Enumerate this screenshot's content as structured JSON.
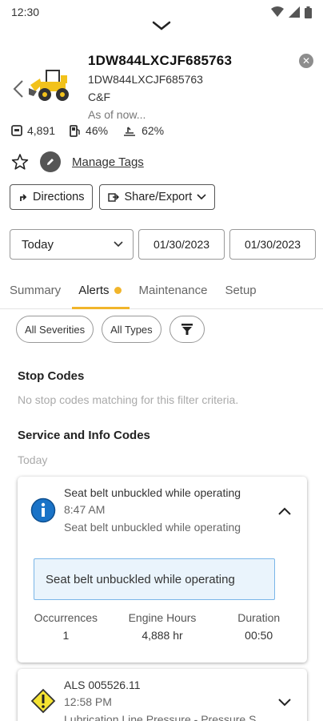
{
  "status_bar": {
    "time": "12:30"
  },
  "asset": {
    "id": "1DW844LXCJF685763",
    "serial": "1DW844LXCJF685763",
    "dealer": "C&F",
    "as_of": "As of now...",
    "hours": "4,891",
    "fuel": "46%",
    "def": "62%"
  },
  "tags": {
    "manage_label": "Manage Tags"
  },
  "actions": {
    "directions": "Directions",
    "share_export": "Share/Export"
  },
  "date_filter": {
    "range": "Today",
    "from": "01/30/2023",
    "to": "01/30/2023"
  },
  "tabs": [
    {
      "label": "Summary"
    },
    {
      "label": "Alerts"
    },
    {
      "label": "Maintenance"
    },
    {
      "label": "Setup"
    }
  ],
  "filters": {
    "severity": "All Severities",
    "types": "All Types"
  },
  "stop_codes": {
    "title": "Stop Codes",
    "empty": "No stop codes matching for this filter criteria."
  },
  "service_codes": {
    "title": "Service and Info Codes",
    "day": "Today"
  },
  "alerts": [
    {
      "title": "Seat belt unbuckled while operating",
      "time": "8:47 AM",
      "description": "Seat belt unbuckled while operating",
      "message": "Seat belt unbuckled while operating",
      "occurrences_label": "Occurrences",
      "occurrences": "1",
      "engine_hours_label": "Engine Hours",
      "engine_hours": "4,888 hr",
      "duration_label": "Duration",
      "duration": "00:50",
      "icon": "info-icon",
      "color": "#1a73c7"
    },
    {
      "title": "ALS 005526.11",
      "time": "12:58 PM",
      "description": "Lubrication Line Pressure - Pressure S",
      "icon": "warning-icon",
      "color": "#f5e332"
    }
  ]
}
